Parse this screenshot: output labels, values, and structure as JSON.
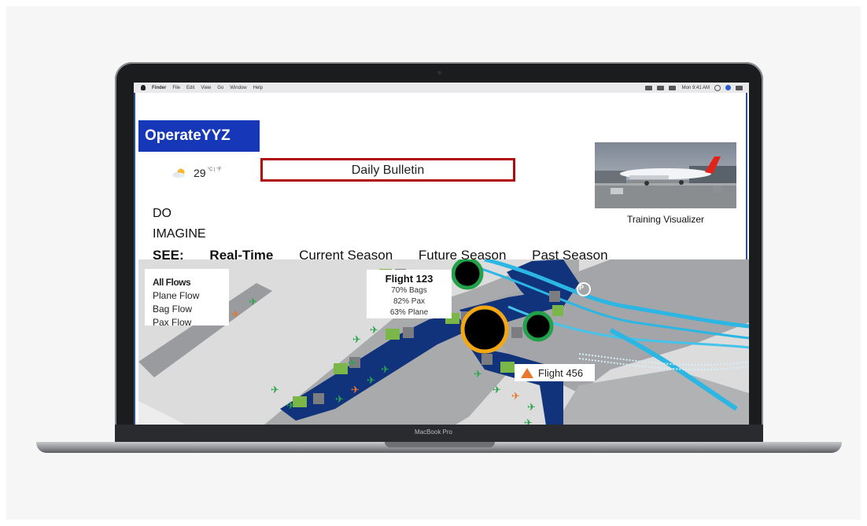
{
  "device_label": "MacBook Pro",
  "menubar": {
    "items": [
      "Finder",
      "File",
      "Edit",
      "View",
      "Go",
      "Window",
      "Help"
    ],
    "clock": "Mon 9:41 AM"
  },
  "app": {
    "logo": "OperateYYZ",
    "weather": {
      "temp": "29",
      "unit": "°C | °F",
      "icon": "partly-cloudy-icon"
    },
    "bulletin": "Daily Bulletin",
    "visualizer_label": "Training Visualizer",
    "line1": "DO",
    "line2": "IMAGINE",
    "seasons": {
      "see": "SEE:",
      "realtime": "Real-Time",
      "current": "Current Season",
      "future": "Future Season",
      "past": "Past Season"
    }
  },
  "map": {
    "legend": {
      "title": "All Flows",
      "items": [
        "Plane Flow",
        "Bag Flow",
        "Pax Flow"
      ]
    },
    "flight_card": {
      "title": "Flight 123",
      "bags": "70% Bags",
      "pax": "82% Pax",
      "plane": "63% Plane"
    },
    "flight_456": "Flight 456",
    "parking_symbol": "P",
    "colors": {
      "terminal": "#10337c",
      "road": "#2bb6e3",
      "green": "#27a74a",
      "orange": "#e8762c",
      "gate_icon": "#7ab648",
      "ring_gold": "#f3a712",
      "ring_green": "#22a04a"
    }
  }
}
